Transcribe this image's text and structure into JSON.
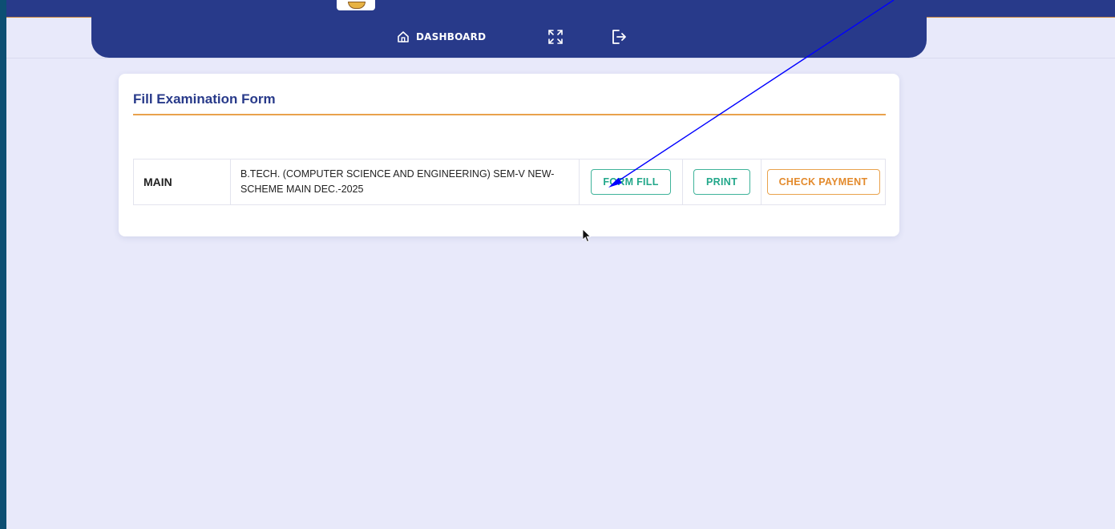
{
  "nav": {
    "dashboard_label": "DASHBOARD"
  },
  "card": {
    "title": "Fill Examination Form"
  },
  "exam_row": {
    "type": "MAIN",
    "course_line1": "B.TECH. (COMPUTER SCIENCE AND ENGINEERING) SEM-V NEW-",
    "course_line2": "SCHEME MAIN DEC.-2025",
    "form_fill_label": "FORM FILL",
    "print_label": "PRINT",
    "check_payment_label": "CHECK PAYMENT"
  },
  "colors": {
    "nav_bg": "#283a8a",
    "page_bg": "#e8e9fa",
    "accent_orange": "#e9a24c",
    "accent_green": "#22a78a",
    "annotation_arrow": "#0000ff"
  },
  "icons": {
    "dashboard": "home-icon",
    "fullscreen": "fullscreen-icon",
    "logout": "logout-icon"
  }
}
